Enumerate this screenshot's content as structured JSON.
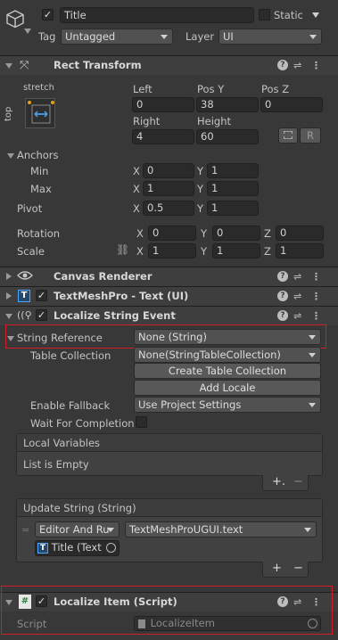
{
  "header": {
    "name": "Title",
    "static_label": "Static",
    "tag_label": "Tag",
    "tag_value": "Untagged",
    "layer_label": "Layer",
    "layer_value": "UI"
  },
  "rect_transform": {
    "title": "Rect Transform",
    "anchor_preset_top": "stretch",
    "anchor_preset_side": "top",
    "left_label": "Left",
    "left_value": "0",
    "posy_label": "Pos Y",
    "posy_value": "38",
    "posz_label": "Pos Z",
    "posz_value": "0",
    "right_label": "Right",
    "right_value": "4",
    "height_label": "Height",
    "height_value": "60",
    "raw_button": "R",
    "anchors_label": "Anchors",
    "min_label": "Min",
    "min_x": "0",
    "min_y": "1",
    "max_label": "Max",
    "max_x": "1",
    "max_y": "1",
    "pivot_label": "Pivot",
    "pivot_x": "0.5",
    "pivot_y": "1",
    "rotation_label": "Rotation",
    "rot_x": "0",
    "rot_y": "0",
    "rot_z": "0",
    "scale_label": "Scale",
    "scale_x": "1",
    "scale_y": "1",
    "scale_z": "1",
    "axis_x": "X",
    "axis_y": "Y",
    "axis_z": "Z"
  },
  "components": {
    "canvas_renderer": "Canvas Renderer",
    "textmeshpro": "TextMeshPro - Text (UI)",
    "localize_string_event": "Localize String Event",
    "localize_item": "Localize Item (Script)"
  },
  "localize_event": {
    "string_reference_label": "String Reference",
    "string_reference_value": "None (String)",
    "table_collection_label": "Table Collection",
    "table_collection_value": "None(StringTableCollection)",
    "create_table_button": "Create Table Collection",
    "add_locale_button": "Add Locale",
    "enable_fallback_label": "Enable Fallback",
    "enable_fallback_value": "Use Project Settings",
    "wait_label": "Wait For Completion",
    "local_vars_title": "Local Variables",
    "list_empty": "List is Empty",
    "update_string_title": "Update String (String)",
    "runtime_value": "Editor And Ru",
    "function_value": "TextMeshProUGUI.text",
    "target_value": "Title (Text"
  },
  "localize_item": {
    "script_label": "Script",
    "script_value": "LocalizeItem"
  }
}
